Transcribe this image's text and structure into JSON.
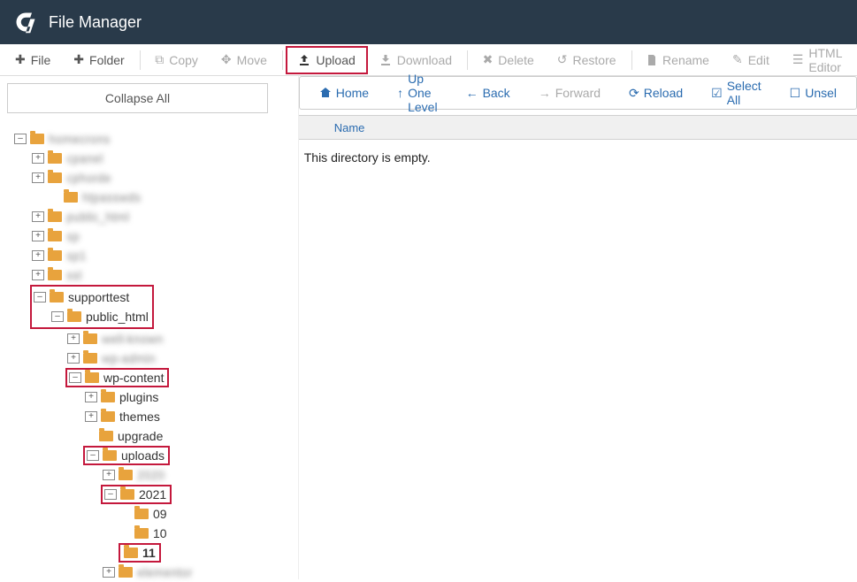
{
  "header": {
    "title": "File Manager"
  },
  "toolbar": {
    "file": "File",
    "folder": "Folder",
    "copy": "Copy",
    "move": "Move",
    "upload": "Upload",
    "download": "Download",
    "delete": "Delete",
    "restore": "Restore",
    "rename": "Rename",
    "edit": "Edit",
    "html_editor": "HTML Editor"
  },
  "sidebar": {
    "collapse_all": "Collapse All"
  },
  "tree": {
    "root": "homecrons",
    "lvl1": [
      "cpanel",
      "cphorde"
    ],
    "cphorde_child": "htpasswds",
    "lvl1b": [
      "public_html",
      "sp",
      "sp1",
      "ssl"
    ],
    "supporttest": "supporttest",
    "public_html": "public_html",
    "ph_children_blur": [
      "well-known",
      "wp-admin"
    ],
    "wp_content": "wp-content",
    "plugins": "plugins",
    "themes": "themes",
    "upgrade": "upgrade",
    "uploads": "uploads",
    "uploads_blur": "2020",
    "y2021": "2021",
    "m09": "09",
    "m10": "10",
    "m11": "11",
    "after_blur": "elementor"
  },
  "nav": {
    "home": "Home",
    "up": "Up One Level",
    "back": "Back",
    "forward": "Forward",
    "reload": "Reload",
    "select_all": "Select All",
    "unselect": "Unsel"
  },
  "grid": {
    "col_name": "Name",
    "empty": "This directory is empty."
  }
}
